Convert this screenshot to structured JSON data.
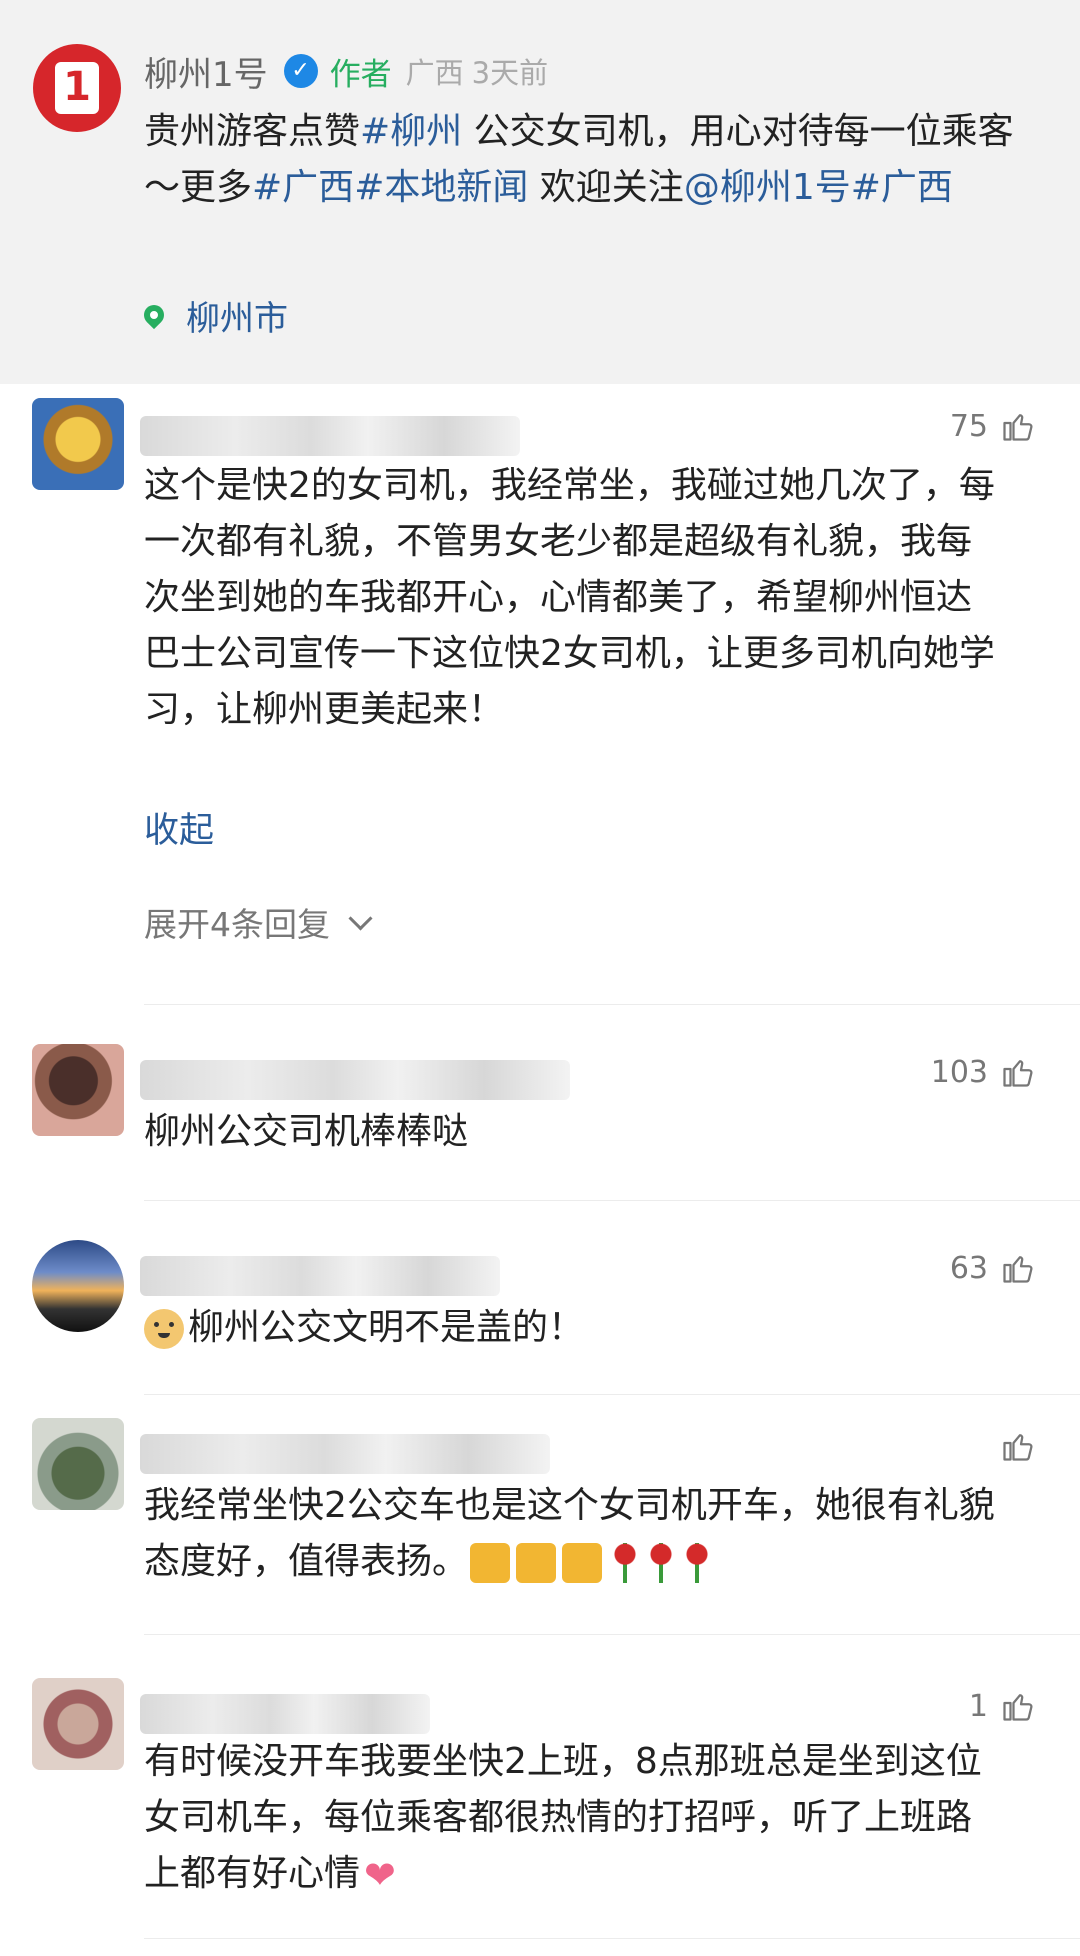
{
  "post": {
    "author": "柳州1号",
    "author_tag": "作者",
    "region": "广西",
    "time": "3天前",
    "text_intro": "贵州游客点赞",
    "tag_1": "#柳州",
    "text_mid": " 公交女司机，用心对待每一位乘客～更多",
    "tag_2": "#广西",
    "tag_3": "#本地新闻",
    "text_follow": " 欢迎关注",
    "mention": "@柳州1号",
    "tag_4": "#广西",
    "location": "柳州市"
  },
  "comments": [
    {
      "likes": "75",
      "text": "这个是快2的女司机，我经常坐，我碰过她几次了，每一次都有礼貌，不管男女老少都是超级有礼貌，我每次坐到她的车我都开心，心情都美了，希望柳州恒达巴士公司宣传一下这位快2女司机，让更多司机向她学习，让柳州更美起来！",
      "collapse_label": "收起",
      "expand_label": "展开4条回复"
    },
    {
      "likes": "103",
      "text": "柳州公交司机棒棒哒"
    },
    {
      "likes": "63",
      "text": "柳州公交文明不是盖的！"
    },
    {
      "likes": "",
      "text": "我经常坐快2公交车也是这个女司机开车，她很有礼貌态度好，值得表扬。"
    },
    {
      "likes": "1",
      "text": "有时候没开车我要坐快2上班，8点那班总是坐到这位女司机车，每位乘客都很热情的打招呼，听了上班路上都有好心情"
    }
  ],
  "colors": {
    "link": "#2b5d9a",
    "author_tag": "#27ae60",
    "logo": "#d6262b",
    "verified": "#1e88e5"
  },
  "icons": [
    "logo-icon",
    "verified-icon",
    "location-pin-icon",
    "thumbs-up-icon",
    "chevron-down-icon",
    "doge-emoji-icon",
    "thumbs-up-emoji-icon",
    "rose-emoji-icon",
    "heart-emoji-icon"
  ]
}
